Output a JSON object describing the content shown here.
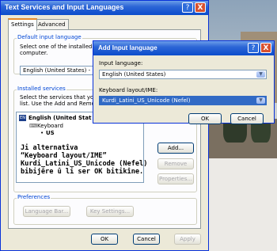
{
  "main_dialog": {
    "title": "Text Services and Input Languages",
    "help_btn": "?",
    "close_btn": "X",
    "tabs": [
      "Settings",
      "Advanced"
    ],
    "default_input": {
      "group_title": "Default input language",
      "desc_line1": "Select one of the installed input",
      "desc_line2": "computer.",
      "selected": "English (United States) - US"
    },
    "installed": {
      "group_title": "Installed services",
      "desc_line1": "Select the services that you w",
      "desc_line2": "list. Use the Add and Remove",
      "tree_lang": "English (United Stat",
      "tree_kb": "Keyboard",
      "tree_us": "US",
      "lang_badge": "EN",
      "add_btn": "Add...",
      "remove_btn": "Remove",
      "properties_btn": "Properties..."
    },
    "caption": "Ji alternatîva\n“Keyboard layout/IME”\nKurdi_Latini_US_Unicode (Nefel)\nbibijêre û li ser OK bitikîne.",
    "preferences": {
      "group_title": "Preferences",
      "language_bar_btn": "Language Bar...",
      "key_settings_btn": "Key Settings..."
    },
    "ok": "OK",
    "cancel": "Cancel",
    "apply": "Apply"
  },
  "add_dialog": {
    "title": "Add Input language",
    "help_btn": "?",
    "close_btn": "X",
    "input_label": "Input language:",
    "input_value": "English (United States)",
    "kb_label": "Keyboard layout/IME:",
    "kb_value": "Kurdi_Latini_US_Unicode (Nefel)",
    "ok": "OK",
    "cancel": "Cancel"
  }
}
